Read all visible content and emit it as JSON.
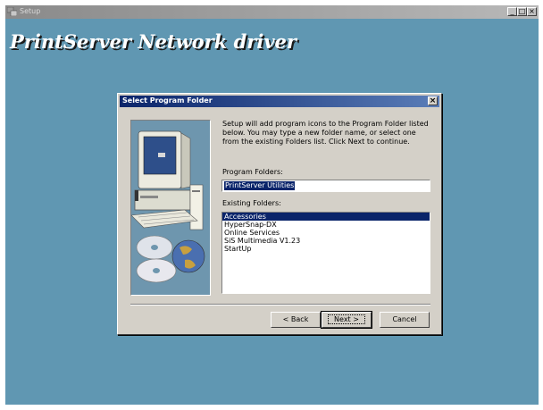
{
  "window": {
    "title": "Setup",
    "min_label": "_",
    "max_label": "□",
    "close_label": "×"
  },
  "banner": "PrintServer Network driver",
  "dialog": {
    "title": "Select Program Folder",
    "close_label": "×",
    "description": "Setup will add program icons to the Program Folder listed below. You may type a new folder name, or select one from the existing Folders list.  Click Next to continue.",
    "program_folders_label": "Program Folders:",
    "program_folder_value": "PrintServer Utilities",
    "existing_folders_label": "Existing Folders:",
    "existing_folders": [
      "Accessories",
      "HyperSnap-DX",
      "Online Services",
      "SiS Multimedia V1.23",
      "StartUp"
    ],
    "selected_folder": "Accessories",
    "buttons": {
      "back": "< Back",
      "next": "Next >",
      "cancel": "Cancel"
    }
  },
  "colors": {
    "desktop": "#6097b2",
    "dialog": "#d4d0c8",
    "titlebar": "#0a246a"
  }
}
